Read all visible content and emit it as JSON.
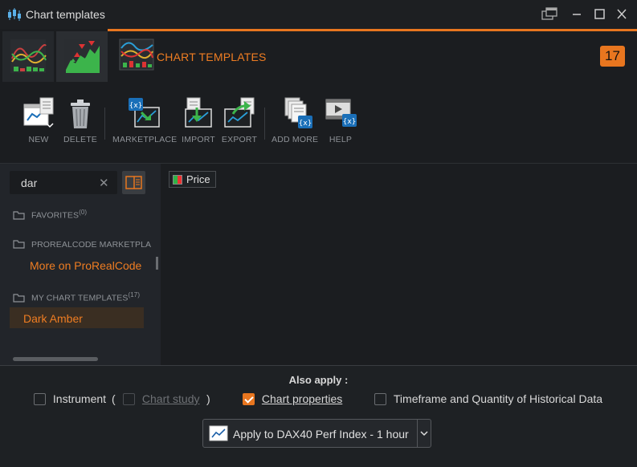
{
  "window": {
    "title": "Chart templates"
  },
  "header": {
    "title": "CHART TEMPLATES",
    "count": "17"
  },
  "toolbar": {
    "new_label": "NEW",
    "delete_label": "DELETE",
    "marketplace_label": "MARKETPLACE",
    "import_label": "IMPORT",
    "export_label": "EXPORT",
    "add_more_label": "ADD MORE",
    "help_label": "HELP"
  },
  "sidebar": {
    "search_value": "dar",
    "favorites": {
      "label": "FAVORITES",
      "count": "(0)"
    },
    "marketplace": {
      "label": "PROREALCODE MARKETPLA",
      "link": "More on ProRealCode"
    },
    "my_templates": {
      "label": "MY CHART TEMPLATES",
      "count": "(17)",
      "items": [
        "Dark Amber"
      ]
    }
  },
  "main": {
    "price_label": "Price"
  },
  "footer": {
    "also_apply": "Also apply :",
    "instrument_label": "Instrument",
    "open_paren": "(",
    "chart_study_label": "Chart study",
    "close_paren": ")",
    "chart_properties_label": "Chart properties",
    "timeframe_label": "Timeframe and Quantity of Historical Data",
    "apply_button": "Apply to DAX40 Perf Index - 1 hour"
  },
  "colors": {
    "accent": "#e8761f",
    "background": "#1e2124"
  }
}
